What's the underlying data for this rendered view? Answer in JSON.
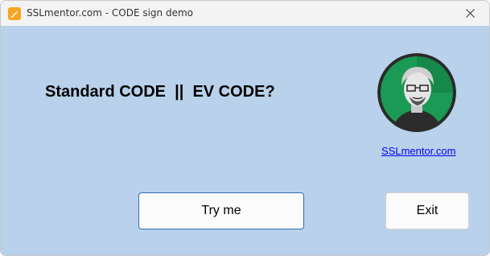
{
  "window": {
    "title": "SSLmentor.com - CODE sign demo",
    "background": "#b9d1ea"
  },
  "main": {
    "question": "Standard CODE  ||  EV CODE?",
    "link_text": "SSLmentor.com",
    "avatar_icon": "mentor-avatar"
  },
  "buttons": {
    "try_label": "Try me",
    "exit_label": "Exit"
  },
  "icons": {
    "app": "pen-icon",
    "close": "close-icon"
  },
  "colors": {
    "link": "#0000ee",
    "avatar_ring": "#1a9a55",
    "focus_border": "#2f6fb5"
  }
}
